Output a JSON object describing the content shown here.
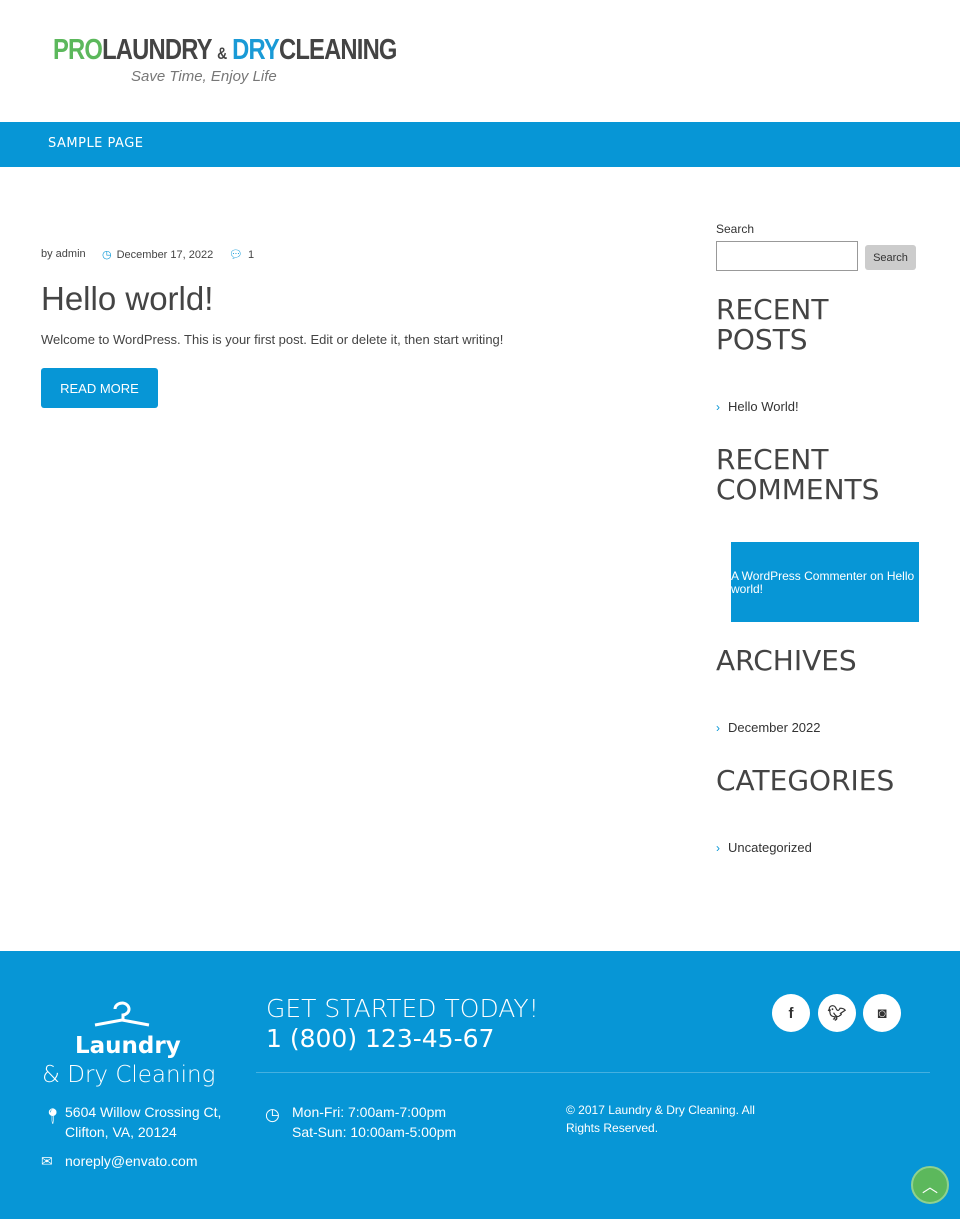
{
  "logo": {
    "pro": "PRO",
    "laundry": "LAUNDRY",
    "amp": "&",
    "dry": "DRY",
    "cleaning": "CLEANING",
    "tagline": "Save Time, Enjoy Life"
  },
  "nav": {
    "items": [
      {
        "label": "SAMPLE PAGE"
      }
    ]
  },
  "post": {
    "author": "by admin",
    "date": "December 17, 2022",
    "comments": "1",
    "title": "Hello world!",
    "excerpt": "Welcome to WordPress. This is your first post. Edit or delete it, then start writing!",
    "read_more": "READ MORE"
  },
  "sidebar": {
    "search_label": "Search",
    "search_placeholder": "",
    "search_button": "Search",
    "recent_posts_title": "RECENT POSTS",
    "recent_posts": [
      "Hello World!"
    ],
    "recent_comments_title": "RECENT COMMENTS",
    "recent_comment": "A WordPress Commenter on Hello world!",
    "archives_title": "ARCHIVES",
    "archives": [
      "December 2022"
    ],
    "categories_title": "CATEGORIES",
    "categories": [
      "Uncategorized"
    ]
  },
  "footer": {
    "logo_line1": "Laundry",
    "logo_line2": "& Dry Cleaning",
    "cta": "GET STARTED TODAY!",
    "phone": "1 (800) 123-45-67",
    "address1": "5604 Willow Crossing Ct,",
    "address2": "Clifton, VA, 20124",
    "email": "noreply@envato.com",
    "hours1": "Mon-Fri: 7:00am-7:00pm",
    "hours2": "Sat-Sun: 10:00am-5:00pm",
    "copyright": "© 2017 Laundry & Dry Cleaning. All Rights Reserved.",
    "social": [
      "facebook-icon",
      "twitter-icon",
      "instagram-icon"
    ]
  },
  "colors": {
    "accent": "#0796d6",
    "green": "#5cb85c"
  }
}
